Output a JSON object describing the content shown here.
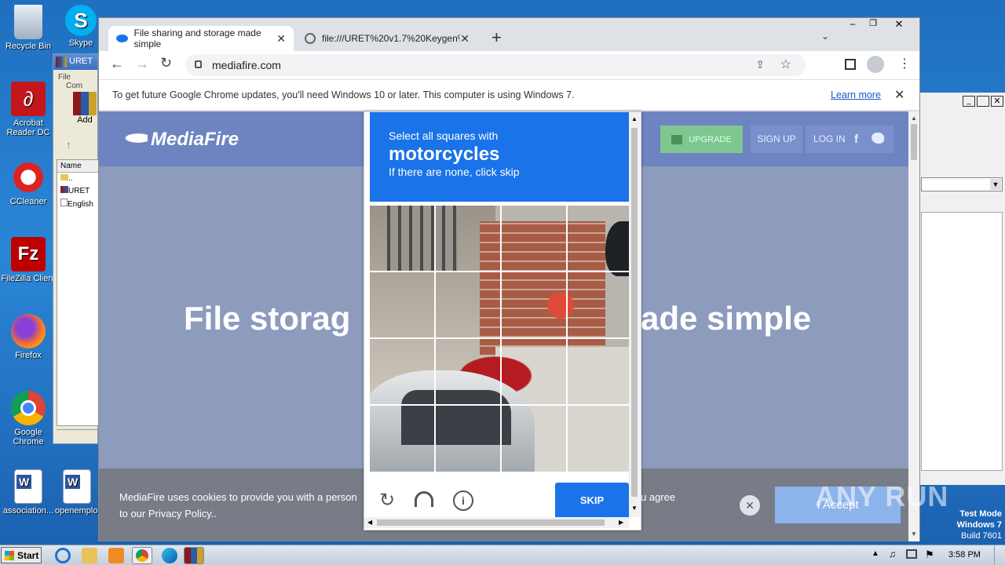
{
  "desktop": {
    "icons": [
      {
        "label": "Recycle Bin"
      },
      {
        "label": "Skype"
      },
      {
        "label": "Acrobat Reader DC"
      },
      {
        "label": "CCleaner"
      },
      {
        "label": "FileZilla Client"
      },
      {
        "label": "Firefox"
      },
      {
        "label": "Google Chrome"
      },
      {
        "label": "association..."
      },
      {
        "label": "openemplo..."
      }
    ],
    "watermark": "ANY RUN",
    "os_mode": {
      "line1": "Test Mode",
      "line2": "Windows 7",
      "line3": "Build 7601"
    }
  },
  "winrar": {
    "title": "URET",
    "menu": [
      "File",
      "Com"
    ],
    "add_label": "Add",
    "column": "Name",
    "files": [
      "..",
      "URET",
      "English"
    ]
  },
  "chrome": {
    "tabs": [
      {
        "title": "File sharing and storage made simple",
        "active": true
      },
      {
        "title": "file:///URET%20v1.7%20Keygen%",
        "active": false
      }
    ],
    "url": "mediafire.com",
    "infobar": {
      "text": "To get future Google Chrome updates, you'll need Windows 10 or later. This computer is using Windows 7.",
      "link": "Learn more"
    }
  },
  "mediafire": {
    "logo": "MediaFire",
    "upgrade": "UPGRADE",
    "signup": "SIGN UP",
    "login": "LOG IN",
    "hero_left": "File storag",
    "hero_right": "ade simple",
    "cookie_left_1": "MediaFire uses cookies to provide you with a person",
    "cookie_left_2": "to our Privacy Policy..",
    "cookie_right": "u agree",
    "accept": "I Accept"
  },
  "captcha": {
    "instruction": "Select all squares with",
    "target": "motorcycles",
    "subtext": "If there are none, click skip",
    "skip": "SKIP"
  },
  "taskbar": {
    "start": "Start",
    "time": "3:58 PM"
  },
  "colors": {
    "captcha_blue": "#1a73e8",
    "mediafire_header": "#6e84c0",
    "upgrade_green": "#7ec88f"
  }
}
